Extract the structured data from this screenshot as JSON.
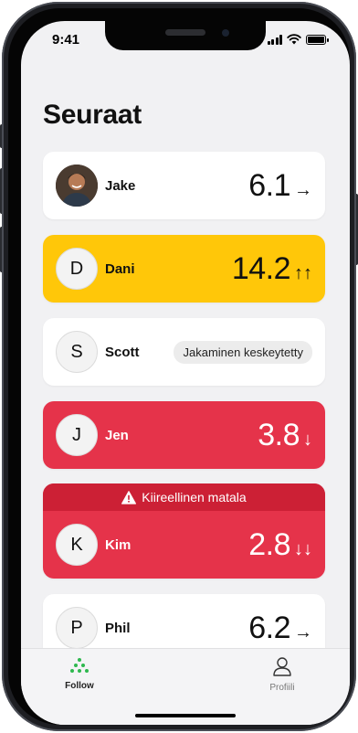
{
  "status_bar": {
    "time": "9:41"
  },
  "page": {
    "title": "Seuraat"
  },
  "followers": [
    {
      "name": "Jake",
      "initial": "",
      "value": "6.1",
      "trend": "→",
      "style": "white"
    },
    {
      "name": "Dani",
      "initial": "D",
      "value": "14.2",
      "trend": "↑↑",
      "style": "yellow"
    },
    {
      "name": "Scott",
      "initial": "S",
      "status": "Jakaminen keskeytetty",
      "style": "white"
    },
    {
      "name": "Jen",
      "initial": "J",
      "value": "3.8",
      "trend": "↓",
      "style": "red"
    },
    {
      "name": "Kim",
      "initial": "K",
      "value": "2.8",
      "trend": "↓↓",
      "style": "red",
      "alert": "Kiireellinen matala"
    },
    {
      "name": "Phil",
      "initial": "P",
      "value": "6.2",
      "trend": "→",
      "style": "white"
    }
  ],
  "tabbar": {
    "follow_label": "Follow",
    "profile_label": "Profiili"
  },
  "colors": {
    "background": "#f1f1f3",
    "yellow": "#ffc709",
    "red": "#e5334a",
    "alert_red": "#cc2035",
    "follow_icon_green": "#2eb84f"
  },
  "icons": {
    "signal": "signal-icon",
    "wifi": "wifi-icon",
    "battery": "battery-icon",
    "warning": "warning-triangle-icon",
    "follow": "follow-dots-icon",
    "profile": "person-icon"
  }
}
